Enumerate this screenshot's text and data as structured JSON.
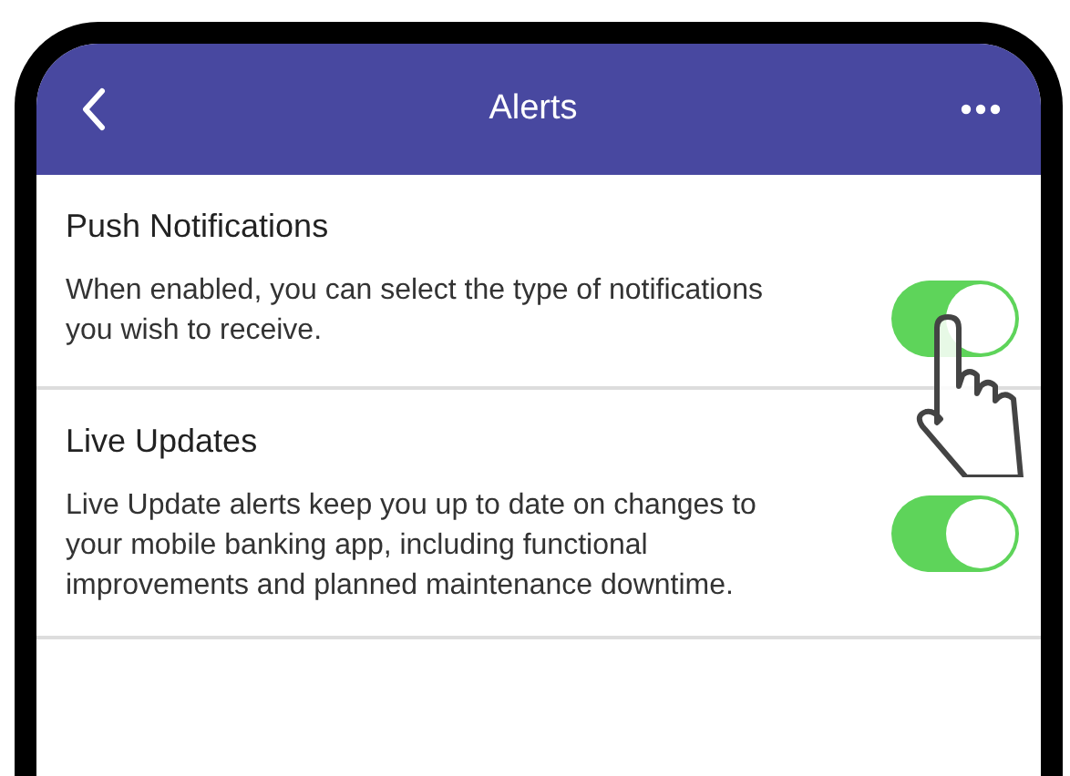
{
  "header": {
    "title": "Alerts"
  },
  "settings": [
    {
      "title": "Push Notifications",
      "description": "When enabled, you can select the type of notifications you wish to receive.",
      "on": true
    },
    {
      "title": "Live Updates",
      "description": "Live Update alerts keep you up to date on changes to your mobile banking app, including functional improvements and planned maintenance downtime.",
      "on": true
    }
  ]
}
